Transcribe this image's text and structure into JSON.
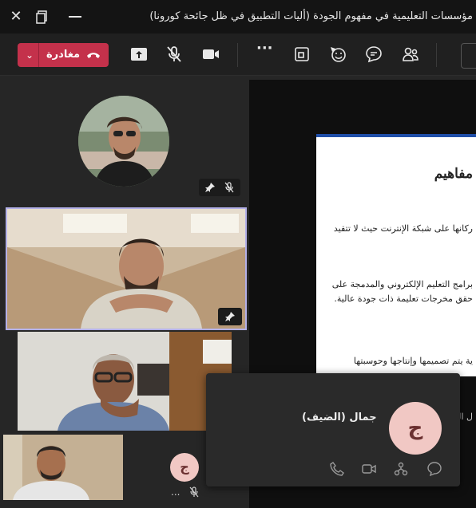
{
  "window": {
    "title": "مؤسسات التعليمية في مفهوم الجودة (أليات التطبيق في ظل جائحة كورونا)"
  },
  "toolbar": {
    "leave_label": "مغادرة"
  },
  "slide": {
    "heading": "مفاهيم",
    "line1": "ركانها على شبكة الإنترنت حيث لا تتقيد",
    "line2": "برامج التعليم الإلكتروني والمدمجة على",
    "line3": "حقق مخرجات تعليمة ذات جودة عالية.",
    "line4": "ية يتم تصميمها وإنتاجها وحوسبتها",
    "line5": "ل الح"
  },
  "participants": {
    "guest_initial": "ج",
    "more": "..."
  },
  "card": {
    "initial": "ج",
    "name": "جمال (الضيف)"
  },
  "colors": {
    "leave": "#c4314b",
    "pin_border": "#b3b0e8",
    "avatar_bg": "#f1c8c4"
  }
}
